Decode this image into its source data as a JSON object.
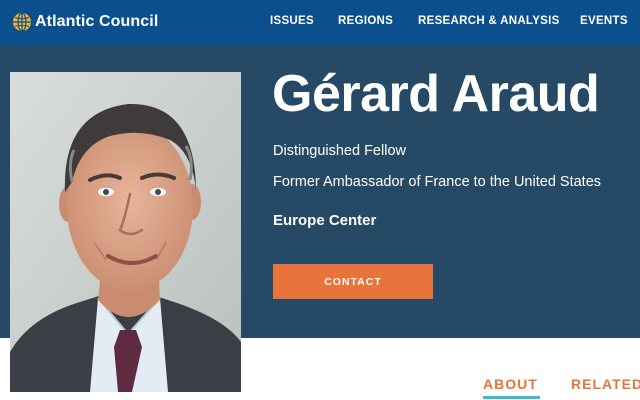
{
  "site": {
    "logo_text": "Atlantic Council",
    "logo_icon": "globe-icon",
    "brand_color": "#0b4f8c"
  },
  "nav": {
    "items": [
      {
        "label": "ISSUES"
      },
      {
        "label": "REGIONS"
      },
      {
        "label": "RESEARCH & ANALYSIS"
      },
      {
        "label": "EVENTS"
      }
    ]
  },
  "profile": {
    "name": "Gérard Araud",
    "title": "Distinguished Fellow",
    "former_role": "Former Ambassador of France to the United States",
    "center": "Europe Center",
    "contact_label": "CONTACT",
    "hero_color": "#264a66",
    "accent_color": "#e8743b"
  },
  "tabs": {
    "items": [
      {
        "label": "ABOUT",
        "active": true
      },
      {
        "label": "RELATED"
      }
    ],
    "active_underline_color": "#3fb8c8"
  }
}
